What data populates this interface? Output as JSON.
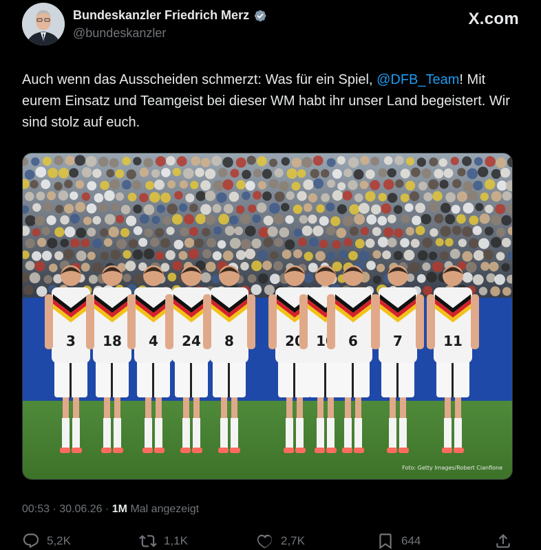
{
  "profile": {
    "display_name": "Bundeskanzler Friedrich Merz",
    "handle": "@bundeskanzler",
    "verified": true,
    "avatar_icon": "profile-avatar"
  },
  "brand": {
    "label": "X.com"
  },
  "tweet": {
    "text_before": "Auch wenn das Ausscheiden schmerzt: Was für ein Spiel, ",
    "mention": "@DFB_Team",
    "text_after": "! Mit eurem Einsatz und Teamgeist bei dieser WM habt ihr unser Land begeistert. Wir sind stolz auf euch."
  },
  "media": {
    "credit": "Foto: Getty Images/Robert Cianflone",
    "jersey_numbers": [
      "3",
      "18",
      "4",
      "24",
      "8",
      "20",
      "10",
      "6",
      "7",
      "11"
    ]
  },
  "meta": {
    "time": "00:53",
    "date": "30.06.26",
    "views_count": "1M",
    "views_label": "Mal angezeigt"
  },
  "actions": {
    "replies": "5,2K",
    "reposts": "1,1K",
    "likes": "2,7K",
    "bookmarks": "644"
  },
  "colors": {
    "background": "#000000",
    "text": "#e7e9ea",
    "secondary": "#71767b",
    "link": "#1d9bf0",
    "verified": "#829aab"
  }
}
